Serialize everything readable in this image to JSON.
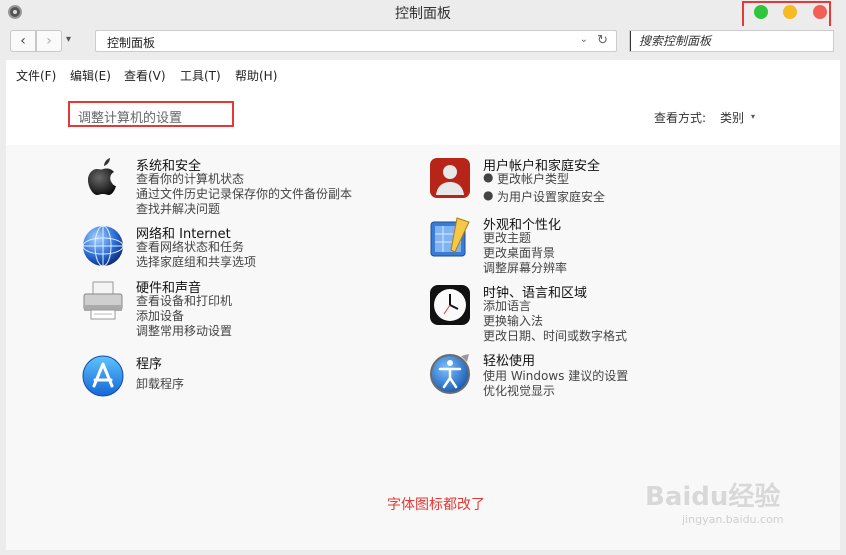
{
  "window": {
    "title": "控制面板"
  },
  "toolbar": {
    "back_glyph": "‹",
    "forward_glyph": "›",
    "history_glyph": "▾",
    "address": "控制面板",
    "address_dropdown": "⌄",
    "refresh_glyph": "↻",
    "search_placeholder": "搜索控制面板"
  },
  "menu": [
    "文件(F)",
    "编辑(E)",
    "查看(V)",
    "工具(T)",
    "帮助(H)"
  ],
  "header": {
    "adjust_label": "调整计算机的设置",
    "view_label": "查看方式:",
    "view_value": "类别",
    "view_caret": "▾"
  },
  "categories": {
    "left": [
      {
        "title": "系统和安全",
        "links": [
          "查看你的计算机状态",
          "通过文件历史记录保存你的文件备份副本",
          "查找并解决问题"
        ]
      },
      {
        "title": "网络和 Internet",
        "links": [
          "查看网络状态和任务",
          "选择家庭组和共享选项"
        ]
      },
      {
        "title": "硬件和声音",
        "links": [
          "查看设备和打印机",
          "添加设备",
          "调整常用移动设置"
        ]
      },
      {
        "title": "程序",
        "links": [
          "卸载程序"
        ]
      }
    ],
    "right": [
      {
        "title": "用户帐户和家庭安全",
        "links": [
          "更改帐户类型",
          "为用户设置家庭安全"
        ]
      },
      {
        "title": "外观和个性化",
        "links": [
          "更改主题",
          "更改桌面背景",
          "调整屏幕分辨率"
        ]
      },
      {
        "title": "时钟、语言和区域",
        "links": [
          "添加语言",
          "更换输入法",
          "更改日期、时间或数字格式"
        ]
      },
      {
        "title": "轻松使用",
        "links": [
          "使用 Windows 建议的设置",
          "优化视觉显示"
        ]
      }
    ]
  },
  "annotation": "字体图标都改了",
  "watermark": {
    "text": "Baidu经验",
    "sub": "jingyan.baidu.com"
  },
  "colors": {
    "accent_red": "#e53935",
    "traffic_green": "#2fc53c",
    "traffic_yellow": "#f6ba22",
    "traffic_red": "#f25f55"
  }
}
